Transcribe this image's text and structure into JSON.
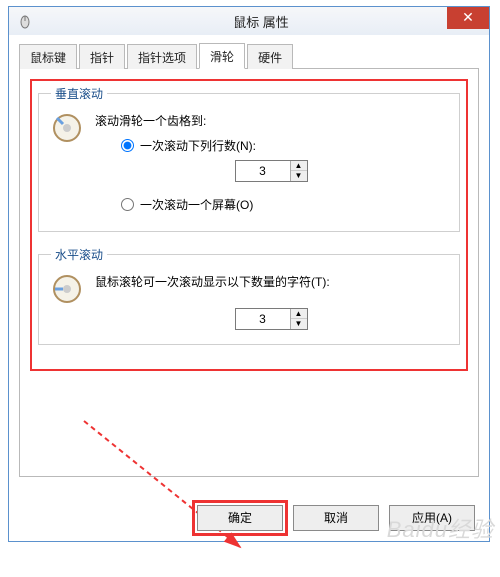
{
  "window": {
    "title": "鼠标 属性"
  },
  "tabs": {
    "t0": "鼠标键",
    "t1": "指针",
    "t2": "指针选项",
    "t3": "滑轮",
    "t4": "硬件"
  },
  "vertical": {
    "legend": "垂直滚动",
    "desc": "滚动滑轮一个齿格到:",
    "opt_lines": "一次滚动下列行数(N):",
    "lines_value": "3",
    "opt_screen": "一次滚动一个屏幕(O)"
  },
  "horizontal": {
    "legend": "水平滚动",
    "desc": "鼠标滚轮可一次滚动显示以下数量的字符(T):",
    "chars_value": "3"
  },
  "buttons": {
    "ok": "确定",
    "cancel": "取消",
    "apply": "应用(A)"
  },
  "watermark": "Baidu经验"
}
